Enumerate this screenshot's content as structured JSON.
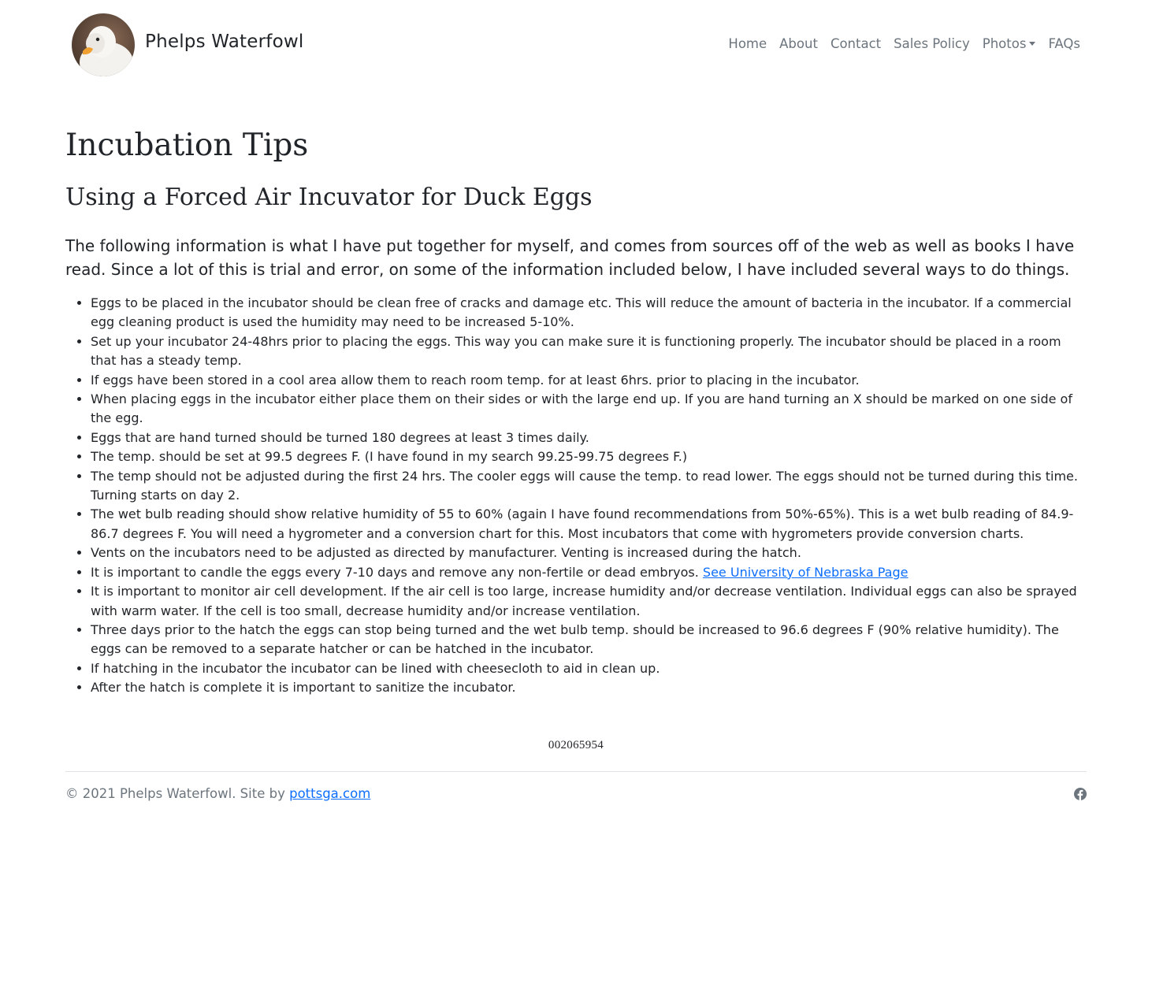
{
  "brand": {
    "name": "Phelps Waterfowl",
    "logo_icon": "duck-avatar"
  },
  "nav": {
    "items": [
      {
        "label": "Home"
      },
      {
        "label": "About"
      },
      {
        "label": "Contact"
      },
      {
        "label": "Sales Policy"
      },
      {
        "label": "Photos"
      },
      {
        "label": "FAQs"
      }
    ]
  },
  "main": {
    "title": "Incubation Tips",
    "subtitle": "Using a Forced Air Incuvator for Duck Eggs",
    "lead": "The following information is what I have put together for myself, and comes from sources off of the web as well as books I have read. Since a lot of this is trial and error, on some of the information included below, I have included several ways to do things.",
    "tips": [
      "Eggs to be placed in the incubator should be clean free of cracks and damage etc. This will reduce the amount of bacteria in the incubator. If a commercial egg cleaning product is used the humidity may need to be increased 5-10%.",
      "Set up your incubator 24-48hrs prior to placing the eggs. This way you can make sure it is functioning properly. The incubator should be placed in a room that has a steady temp.",
      "If eggs have been stored in a cool area allow them to reach room temp. for at least 6hrs. prior to placing in the incubator.",
      "When placing eggs in the incubator either place them on their sides or with the large end up. If you are hand turning an X should be marked on one side of the egg.",
      "Eggs that are hand turned should be turned 180 degrees at least 3 times daily.",
      "The temp. should be set at 99.5 degrees F. (I have found in my search 99.25-99.75 degrees F.)",
      "The temp should not be adjusted during the first 24 hrs. The cooler eggs will cause the temp. to read lower. The eggs should not be turned during this time. Turning starts on day 2.",
      "The wet bulb reading should show relative humidity of 55 to 60% (again I have found recommendations from 50%-65%). This is a wet bulb reading of 84.9-86.7 degrees F. You will need a hygrometer and a conversion chart for this. Most incubators that come with hygrometers provide conversion charts.",
      "Vents on the incubators need to be adjusted as directed by manufacturer. Venting is increased during the hatch.",
      "It is important to candle the eggs every 7-10 days and remove any non-fertile or dead embryos. ",
      "It is important to monitor air cell development. If the air cell is too large, increase humidity and/or decrease ventilation. Individual eggs can also be sprayed with warm water. If the cell is too small, decrease humidity and/or increase ventilation.",
      "Three days prior to the hatch the eggs can stop being turned and the wet bulb temp. should be increased to 96.6 degrees F (90% relative humidity). The eggs can be removed to a separate hatcher or can be hatched in the incubator.",
      "If hatching in the incubator the incubator can be lined with cheesecloth to aid in clean up.",
      "After the hatch is complete it is important to sanitize the incubator."
    ],
    "nebraska_link": "See University of Nebraska Page",
    "counter": "002065954"
  },
  "footer": {
    "copyright": "© 2021 Phelps Waterfowl. Site by ",
    "site_link": "pottsga.com",
    "social_icon": "facebook-icon"
  },
  "colors": {
    "link": "#0d6efd",
    "muted": "#6c757d",
    "text": "#212529"
  }
}
